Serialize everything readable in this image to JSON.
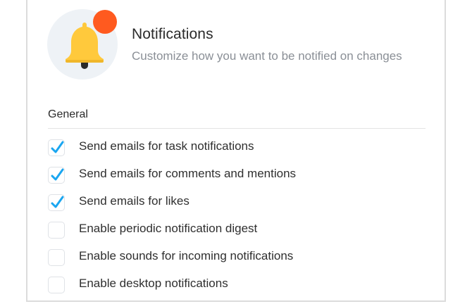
{
  "header": {
    "icon": "bell-icon",
    "badge_color": "#ff5a1f",
    "bell_color": "#ffc93c",
    "title": "Notifications",
    "subtitle": "Customize how you want to be notified on changes"
  },
  "section": {
    "title": "General"
  },
  "accent_color": "#1aa6f0",
  "options": [
    {
      "label": "Send emails for task notifications",
      "checked": true
    },
    {
      "label": "Send emails for comments and mentions",
      "checked": true
    },
    {
      "label": "Send emails for likes",
      "checked": true
    },
    {
      "label": "Enable periodic notification digest",
      "checked": false
    },
    {
      "label": "Enable sounds for incoming notifications",
      "checked": false
    },
    {
      "label": "Enable desktop notifications",
      "checked": false
    }
  ]
}
